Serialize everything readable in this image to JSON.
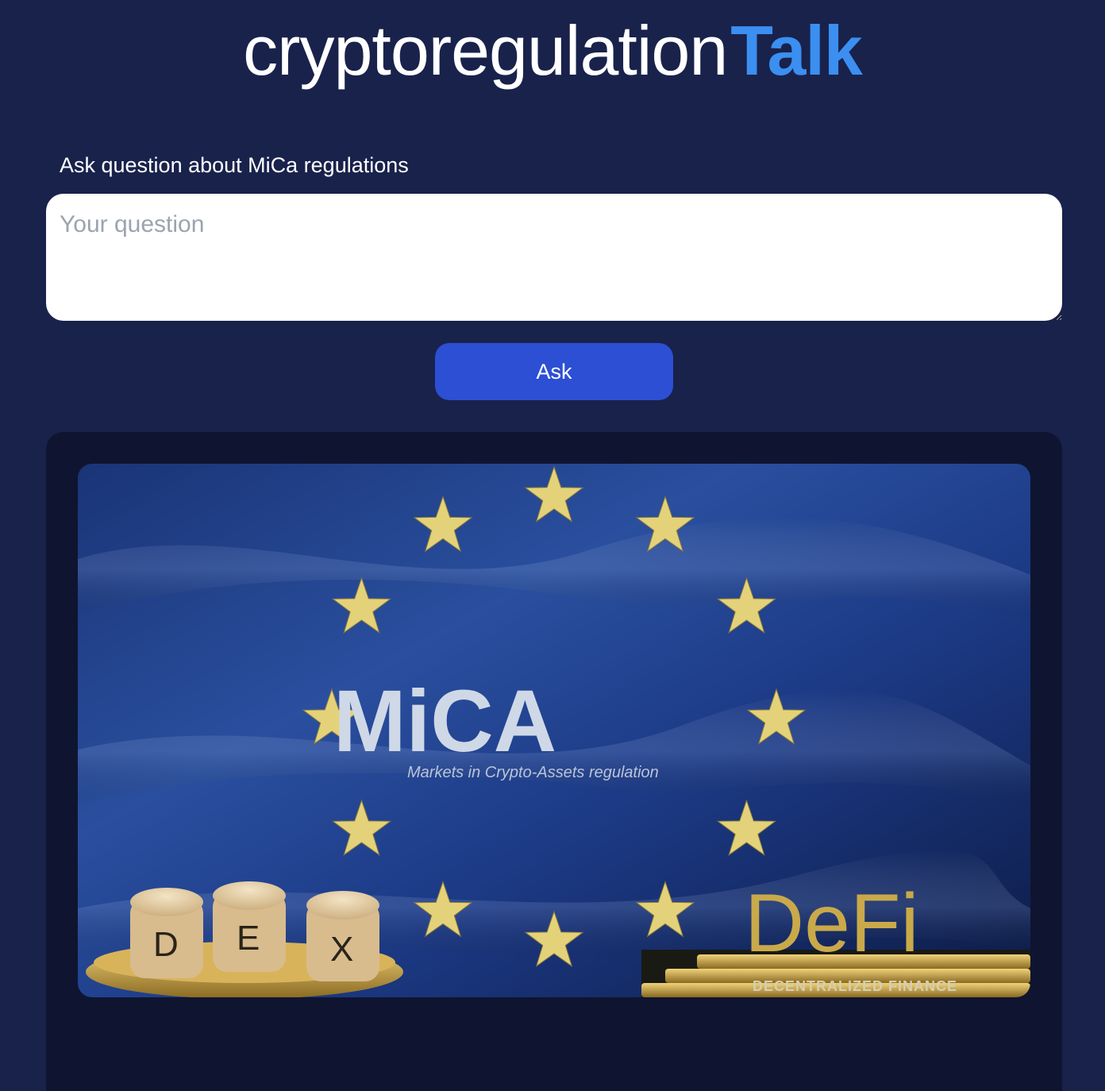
{
  "header": {
    "brand_main": "cryptoregulation",
    "brand_accent": "Talk"
  },
  "form": {
    "label": "Ask question about MiCa regulations",
    "input_value": "",
    "input_placeholder": "Your question",
    "ask_label": "Ask"
  },
  "banner": {
    "title": "MiCA",
    "subtitle": "Markets in Crypto-Assets regulation",
    "cube_letters": [
      "D",
      "E",
      "X"
    ],
    "defi_text": "DeFi",
    "defi_subtitle": "DECENTRALIZED FINANCE",
    "star_count": 12
  },
  "colors": {
    "page_background": "#19224b",
    "brand_accent": "#3b8ff0",
    "button": "#2c4fd3",
    "panel": "#0f1530",
    "flag_blue": "#1f3f8f",
    "star_gold": "#e4d27a"
  }
}
